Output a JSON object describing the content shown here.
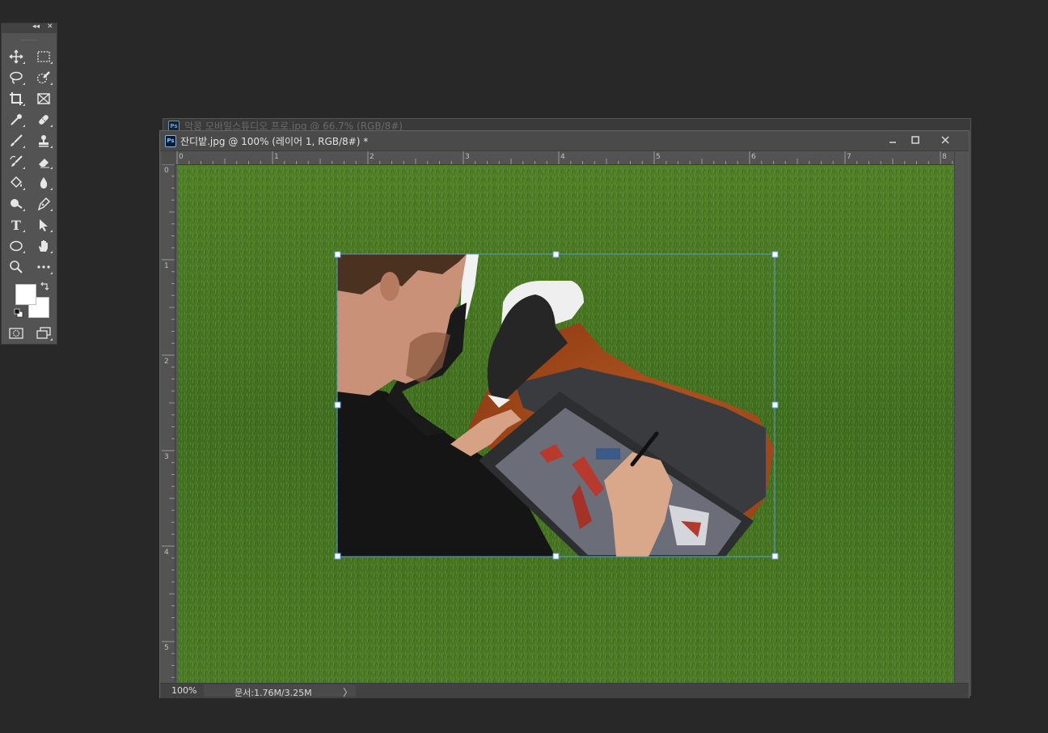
{
  "tools_panel": {
    "collapse_label": "◂◂",
    "close_label": "✕",
    "tools": [
      {
        "icon": "move-icon",
        "col": 0
      },
      {
        "icon": "rectangular-marquee-icon",
        "col": 1
      },
      {
        "icon": "lasso-icon",
        "col": 0
      },
      {
        "icon": "quick-selection-icon",
        "col": 1
      },
      {
        "icon": "crop-icon",
        "col": 0
      },
      {
        "icon": "frame-icon",
        "col": 1
      },
      {
        "icon": "eyedropper-icon",
        "col": 0
      },
      {
        "icon": "healing-brush-icon",
        "col": 1
      },
      {
        "icon": "brush-icon",
        "col": 0
      },
      {
        "icon": "clone-stamp-icon",
        "col": 1
      },
      {
        "icon": "history-brush-icon",
        "col": 0
      },
      {
        "icon": "eraser-icon",
        "col": 1
      },
      {
        "icon": "paint-bucket-icon",
        "col": 0
      },
      {
        "icon": "blur-icon",
        "col": 1
      },
      {
        "icon": "dodge-icon",
        "col": 0
      },
      {
        "icon": "pen-icon",
        "col": 1
      },
      {
        "icon": "type-icon",
        "col": 0
      },
      {
        "icon": "path-selection-icon",
        "col": 1
      },
      {
        "icon": "ellipse-icon",
        "col": 0
      },
      {
        "icon": "hand-icon",
        "col": 1
      },
      {
        "icon": "zoom-icon",
        "col": 0
      },
      {
        "icon": "more-tools-icon",
        "col": 1
      }
    ],
    "type_tool_glyph": "T",
    "foreground_color": "#ffffff",
    "background_color": "#ffffff"
  },
  "back_document": {
    "title": "악콩 모바일스튜디오 프로.jpg @ 66.7% (RGB/8#)"
  },
  "document": {
    "app_icon_label": "Ps",
    "title": "잔디밭.jpg @ 100% (레이어 1, RGB/8#) *",
    "minimize_label": "—",
    "close_label": "✕",
    "hruler_labels": [
      "0",
      "1",
      "2",
      "3",
      "4",
      "5",
      "6",
      "7",
      "8"
    ],
    "vruler_labels": [
      "0",
      "1",
      "2",
      "3",
      "4",
      "5"
    ],
    "status": {
      "zoom": "100%",
      "doc_size": "문서:1.76M/3.25M",
      "arrow": "〉"
    }
  },
  "colors": {
    "app_background": "#282828",
    "panel": "#535353",
    "grass": "#3e6b1f",
    "transform_handle": "#5b9bd5"
  }
}
